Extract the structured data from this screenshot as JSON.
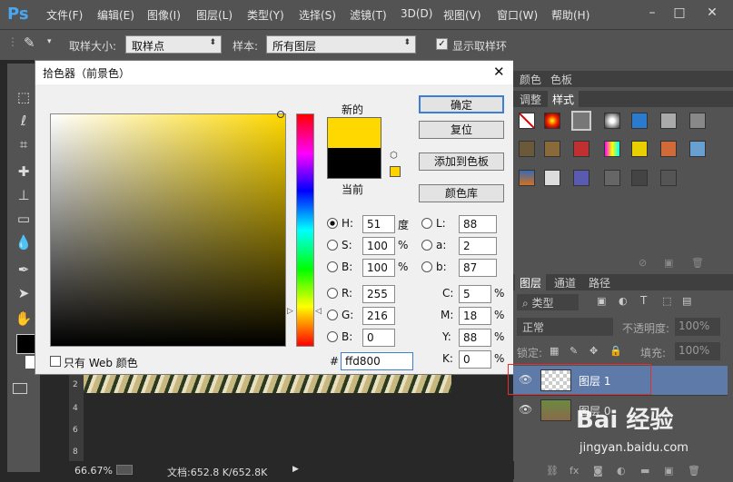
{
  "menubar": {
    "logo": "Ps",
    "items": [
      "文件(F)",
      "编辑(E)",
      "图像(I)",
      "图层(L)",
      "类型(Y)",
      "选择(S)",
      "滤镜(T)",
      "3D(D)",
      "视图(V)",
      "窗口(W)",
      "帮助(H)"
    ]
  },
  "options": {
    "sample_size_label": "取样大小:",
    "sample_size_value": "取样点",
    "sample_label": "样本:",
    "sample_value": "所有图层",
    "show_ring_label": "显示取样环",
    "show_ring_checked": true
  },
  "dialog": {
    "title": "拾色器（前景色）",
    "new_label": "新的",
    "current_label": "当前",
    "new_color": "#ffd800",
    "current_color": "#000000",
    "buttons": {
      "ok": "确定",
      "reset": "复位",
      "add_swatch": "添加到色板",
      "color_library": "颜色库"
    },
    "hsb": {
      "H": {
        "label": "H:",
        "value": "51",
        "unit": "度"
      },
      "S": {
        "label": "S:",
        "value": "100",
        "unit": "%"
      },
      "B": {
        "label": "B:",
        "value": "100",
        "unit": "%"
      }
    },
    "rgb": {
      "R": {
        "label": "R:",
        "value": "255"
      },
      "G": {
        "label": "G:",
        "value": "216"
      },
      "B": {
        "label": "B:",
        "value": "0"
      }
    },
    "lab": {
      "L": {
        "label": "L:",
        "value": "88"
      },
      "a": {
        "label": "a:",
        "value": "2"
      },
      "b": {
        "label": "b:",
        "value": "87"
      }
    },
    "cmyk": {
      "C": {
        "label": "C:",
        "value": "5",
        "unit": "%"
      },
      "M": {
        "label": "M:",
        "value": "18",
        "unit": "%"
      },
      "Y": {
        "label": "Y:",
        "value": "88",
        "unit": "%"
      },
      "K": {
        "label": "K:",
        "value": "0",
        "unit": "%"
      }
    },
    "hex_label": "#",
    "hex_value": "ffd800",
    "web_only_label": "只有 Web 颜色"
  },
  "panels": {
    "swatch_tabs": [
      "颜色",
      "色板"
    ],
    "style_tabs": [
      "调整",
      "样式"
    ],
    "layers_tabs": [
      "图层",
      "通道",
      "路径"
    ],
    "kind_label": "类型",
    "blend_mode": "正常",
    "opacity_label": "不透明度:",
    "opacity_value": "100%",
    "lock_label": "锁定:",
    "fill_label": "填充:",
    "fill_value": "100%",
    "layers": [
      {
        "name": "图层 1"
      },
      {
        "name": "图层 0"
      }
    ]
  },
  "status": {
    "zoom": "66.67%",
    "doc": "文档:652.8 K/652.8K"
  },
  "ruler": {
    "marks": [
      "2",
      "4",
      "6",
      "8"
    ]
  },
  "watermark": {
    "brand": "Bai 经验",
    "url": "jingyan.baidu.com"
  }
}
